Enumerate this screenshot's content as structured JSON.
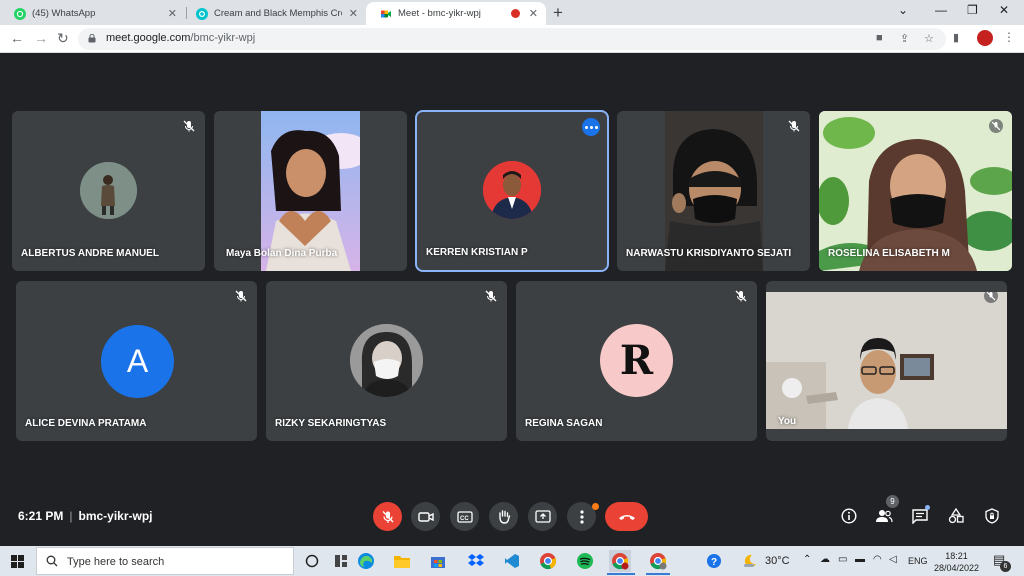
{
  "browser": {
    "tabs": [
      {
        "title": "(45) WhatsApp",
        "active": false,
        "favicon_color": "#25d366"
      },
      {
        "title": "Cream and Black Memphis Creat",
        "active": false,
        "favicon_color": "#00c4cc"
      },
      {
        "title": "Meet - bmc-yikr-wpj",
        "active": true,
        "favicon_color": "#00832d",
        "recording": true
      }
    ],
    "url_host": "meet.google.com",
    "url_path": "/bmc-yikr-wpj",
    "new_tab_label": "+"
  },
  "participants": [
    {
      "name": "ALBERTUS ANDRE MANUEL",
      "muted": true,
      "display": "photo-avatar"
    },
    {
      "name": "Maya Bolan Dina Purba",
      "muted": false,
      "display": "video"
    },
    {
      "name": "KERREN KRISTIAN P",
      "muted": false,
      "display": "photo-avatar",
      "active_speaker": true
    },
    {
      "name": "NARWASTU KRISDIYANTO SEJATI",
      "muted": true,
      "display": "video"
    },
    {
      "name": "ROSELINA ELISABETH M",
      "muted": true,
      "display": "video"
    },
    {
      "name": "ALICE DEVINA PRATAMA",
      "muted": true,
      "display": "letter-avatar",
      "initial": "A"
    },
    {
      "name": "RIZKY SEKARINGTYAS",
      "muted": true,
      "display": "photo-avatar"
    },
    {
      "name": "REGINA SAGAN",
      "muted": true,
      "display": "photo-avatar",
      "avatar_text": "R"
    },
    {
      "name": "You",
      "muted": true,
      "display": "video"
    }
  ],
  "meeting": {
    "time": "6:21 PM",
    "separator": "|",
    "code": "bmc-yikr-wpj",
    "people_count": "9"
  },
  "controls": [
    "mic-off-button",
    "camera-button",
    "captions-button",
    "raise-hand-button",
    "present-button",
    "more-options-button",
    "leave-call-button"
  ],
  "taskbar": {
    "search_placeholder": "Type here to search",
    "temperature": "30°C",
    "language": "ENG",
    "time": "18:21",
    "date": "28/04/2022",
    "notification_count": "6"
  },
  "colors": {
    "meet_bg": "#202124",
    "tile_bg": "#3c4043",
    "danger": "#ea4335",
    "accent": "#1a73e8"
  }
}
